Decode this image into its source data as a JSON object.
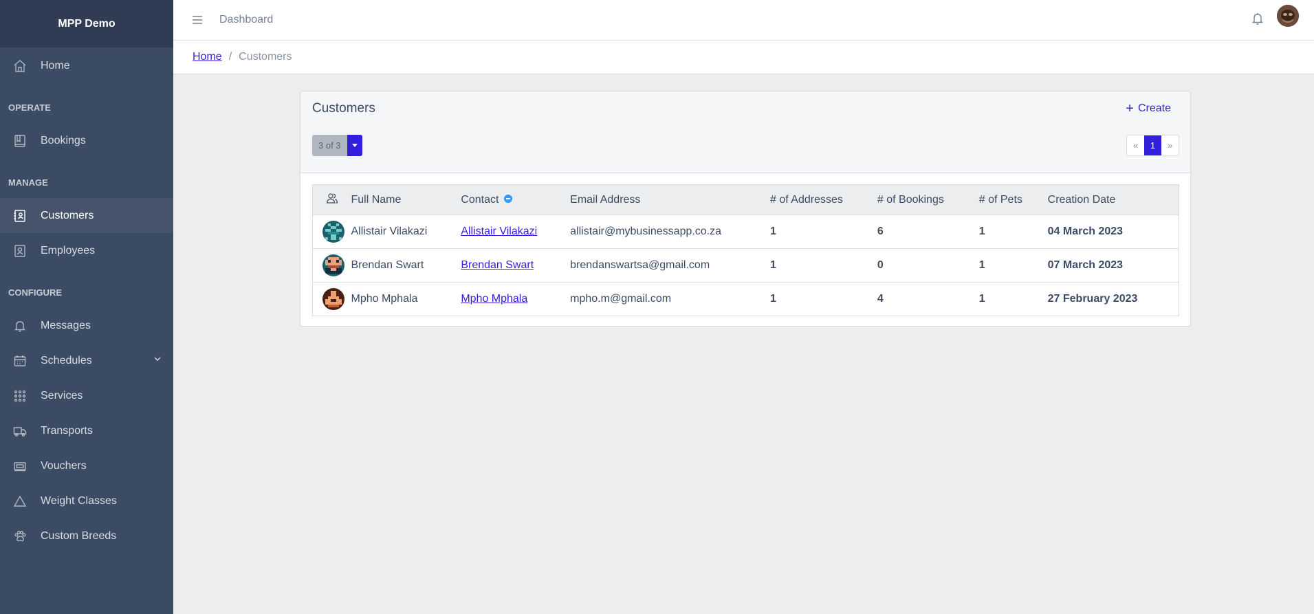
{
  "brand": "MPP Demo",
  "sidebar": {
    "home": "Home",
    "sections": {
      "operate": "OPERATE",
      "manage": "MANAGE",
      "configure": "CONFIGURE"
    },
    "items": {
      "bookings": "Bookings",
      "customers": "Customers",
      "employees": "Employees",
      "messages": "Messages",
      "schedules": "Schedules",
      "services": "Services",
      "transports": "Transports",
      "vouchers": "Vouchers",
      "weight_classes": "Weight Classes",
      "custom_breeds": "Custom Breeds"
    },
    "active": "customers"
  },
  "header": {
    "link": "Dashboard"
  },
  "breadcrumb": {
    "home": "Home",
    "separator": "/",
    "current": "Customers"
  },
  "card": {
    "title": "Customers",
    "create_label": "Create",
    "page_size_label": "3 of 3",
    "pager": {
      "prev": "«",
      "current": "1",
      "next": "»"
    }
  },
  "table": {
    "columns": {
      "full_name": "Full Name",
      "contact": "Contact",
      "email": "Email Address",
      "addresses": "# of Addresses",
      "bookings": "# of Bookings",
      "pets": "# of Pets",
      "created": "Creation Date"
    },
    "rows": [
      {
        "full_name": "Allistair Vilakazi",
        "contact": "Allistair Vilakazi",
        "email": "allistair@mybusinessapp.co.za",
        "addresses": "1",
        "bookings": "6",
        "pets": "1",
        "created": "04 March 2023"
      },
      {
        "full_name": "Brendan Swart",
        "contact": "Brendan Swart",
        "email": "brendanswartsa@gmail.com",
        "addresses": "1",
        "bookings": "0",
        "pets": "1",
        "created": "07 March 2023"
      },
      {
        "full_name": "Mpho Mphala",
        "contact": "Mpho Mphala",
        "email": "mpho.m@gmail.com",
        "addresses": "1",
        "bookings": "4",
        "pets": "1",
        "created": "27 February 2023"
      }
    ]
  },
  "colors": {
    "sidebar_bg": "#3c4b64",
    "brand_bg": "#303c54",
    "primary": "#321fdb",
    "page_bg": "#ebedef",
    "info": "#3399ff"
  }
}
